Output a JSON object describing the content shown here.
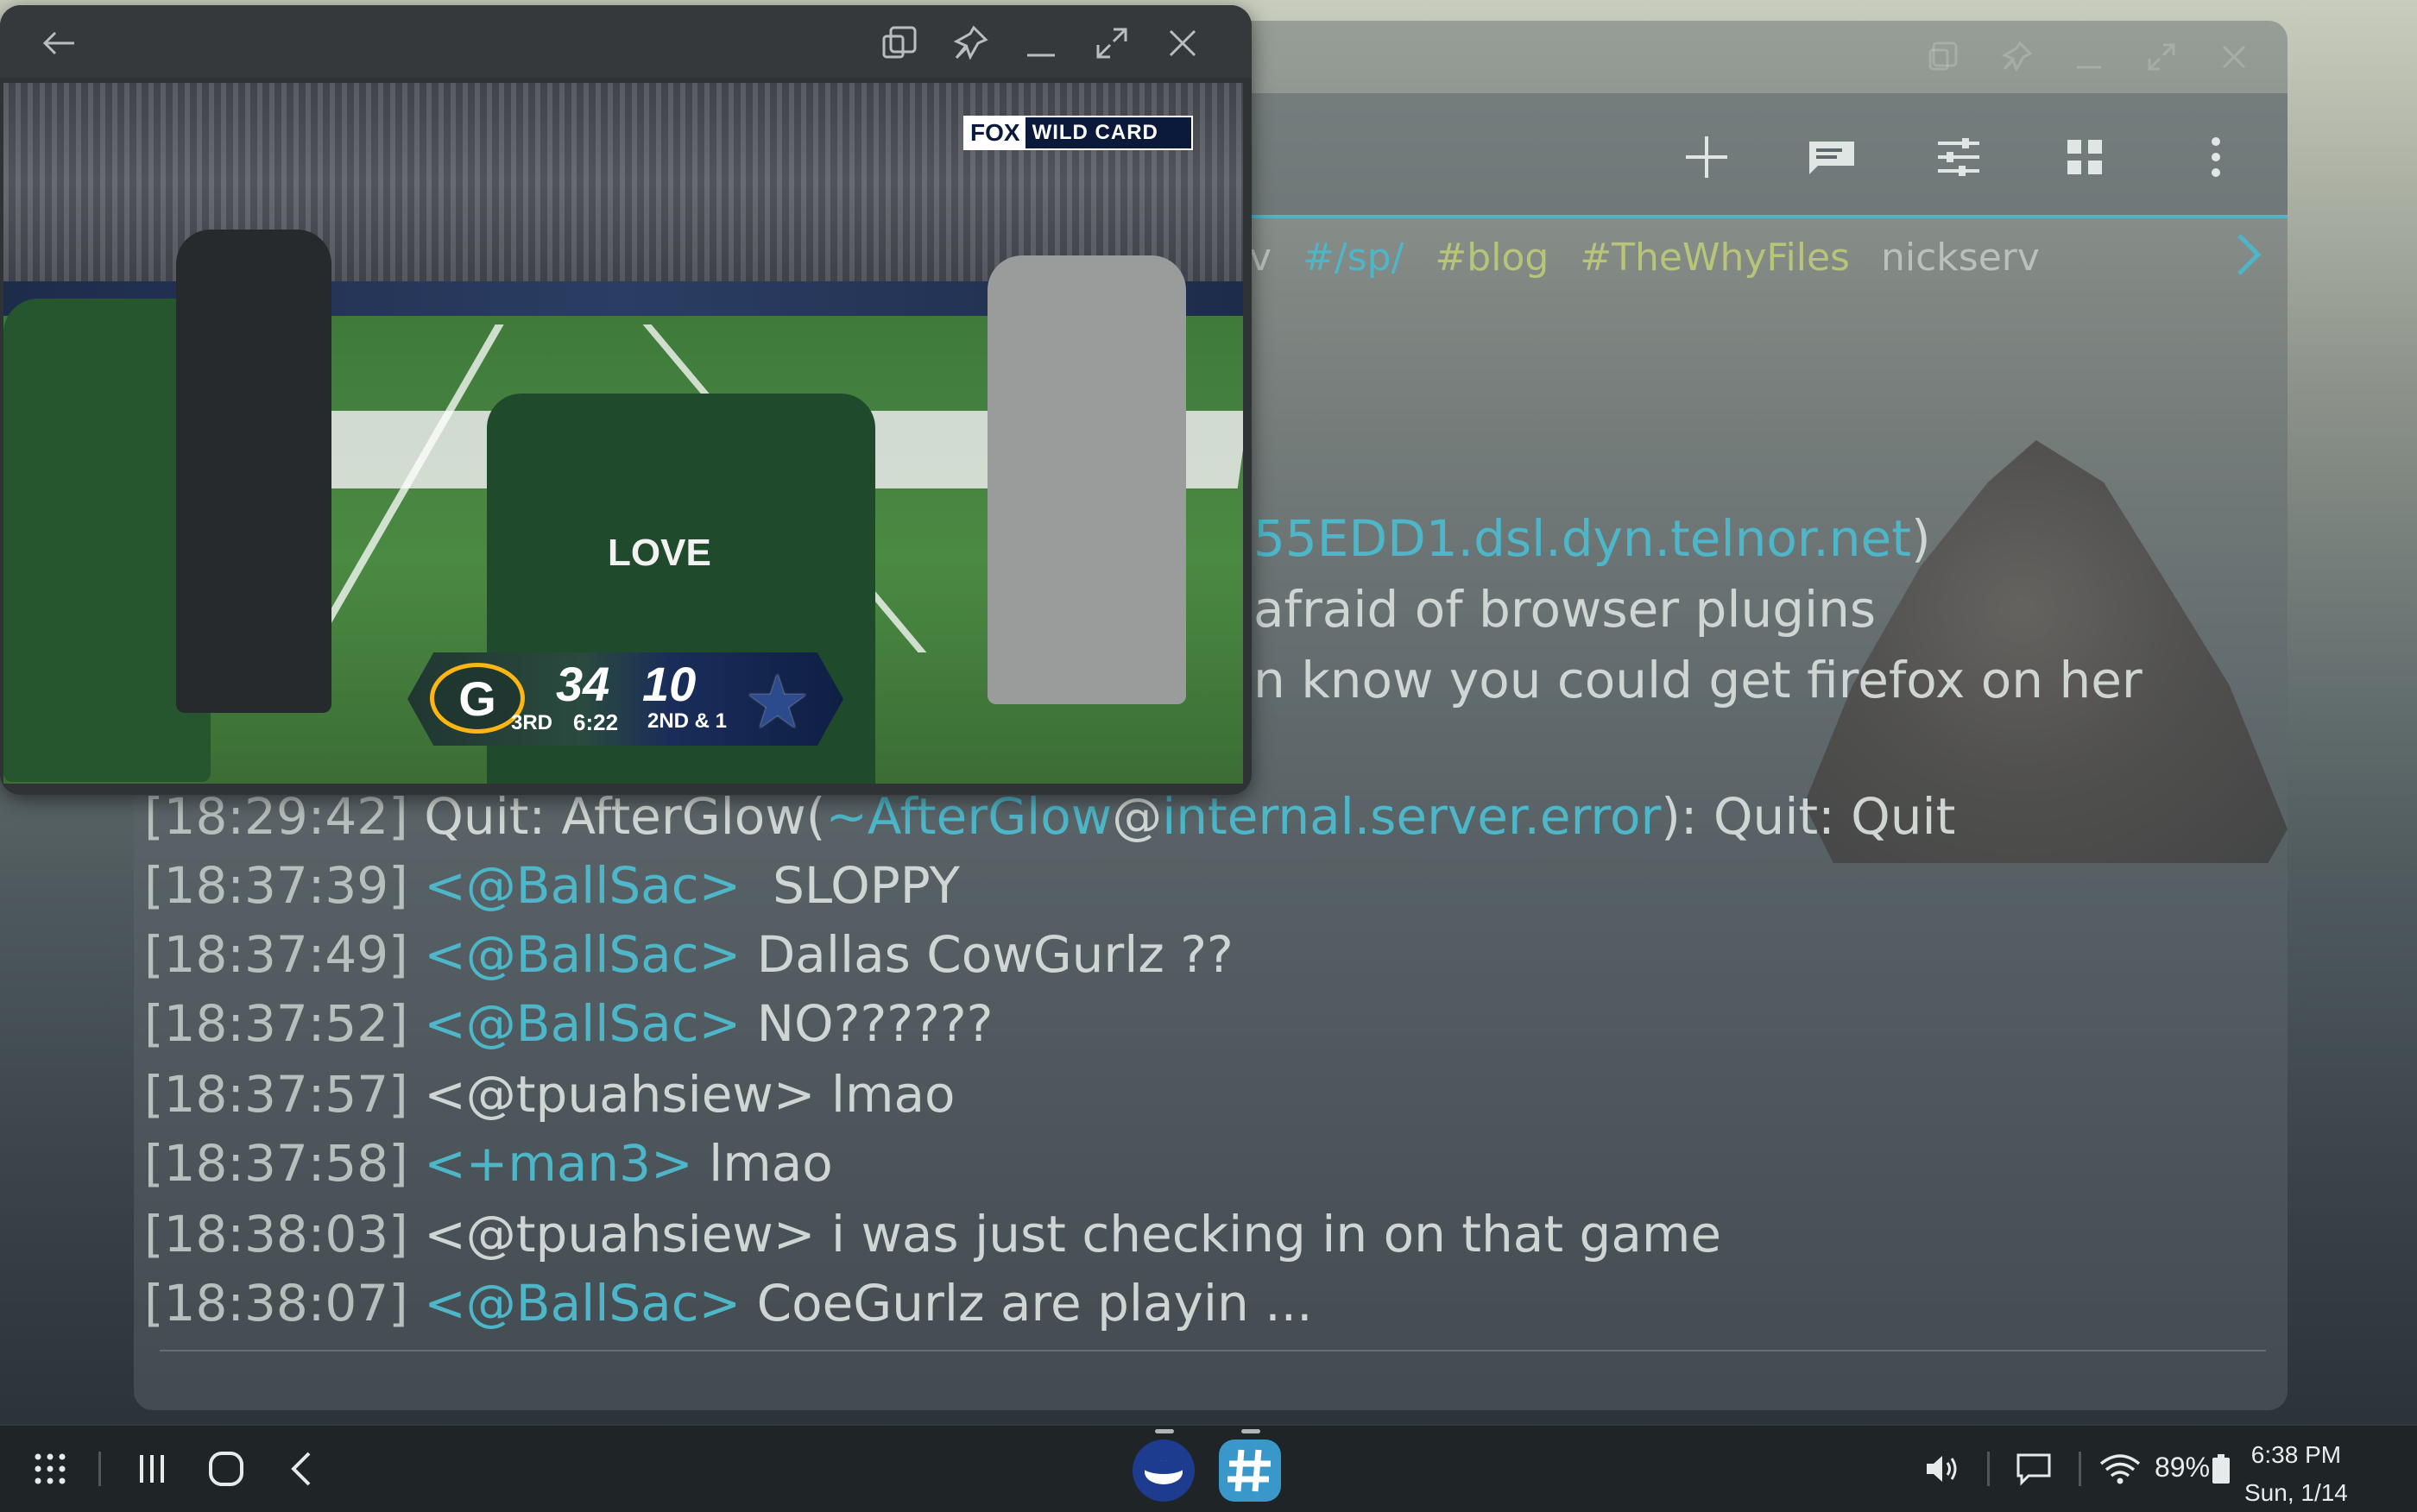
{
  "pip_window": {
    "title": "",
    "video": {
      "broadcast_logo": {
        "network": "FOX",
        "label": "WILD CARD"
      },
      "jersey_name": "LOVE",
      "scorebug": {
        "home_score": "34",
        "away_score": "10",
        "quarter": "3RD",
        "clock": "6:22",
        "down_distance": "2ND & 1"
      }
    }
  },
  "chat_window": {
    "channels": [
      {
        "label": "v",
        "style": "plain"
      },
      {
        "label": "#/sp/",
        "style": "cyan"
      },
      {
        "label": "#blog",
        "style": "olive"
      },
      {
        "label": "#TheWhyFiles",
        "style": "olive"
      },
      {
        "label": "nickserv",
        "style": "nick"
      }
    ],
    "partial_lines": [
      {
        "text": "55EDD1.dsl.dyn.telnor.net",
        "suffix": ")"
      },
      {
        "text": "afraid of browser plugins"
      },
      {
        "text": "n know you could get firefox on her"
      }
    ],
    "messages": [
      {
        "time": "[18:29:42]",
        "prefix": "Quit: AfterGlow(",
        "host_user": "~AfterGlow",
        "at": "@",
        "host": "internal.server.error",
        "rest": "): Quit: Quit"
      },
      {
        "time": "[18:37:39]",
        "nick": "<@BallSac>",
        "text": "  SLOPPY",
        "nick_color": "cyan"
      },
      {
        "time": "[18:37:49]",
        "nick": "<@BallSac>",
        "text": " Dallas CowGurlz ??",
        "nick_color": "cyan"
      },
      {
        "time": "[18:37:52]",
        "nick": "<@BallSac>",
        "text": " NO??????",
        "nick_color": "cyan"
      },
      {
        "time": "[18:37:57]",
        "nick": "<@tpuahsiew>",
        "text": " lmao",
        "nick_color": "plain"
      },
      {
        "time": "[18:37:58]",
        "nick": "<+man3>",
        "text": " lmao",
        "nick_color": "cyan"
      },
      {
        "time": "[18:38:03]",
        "nick": "<@tpuahsiew>",
        "text": " i was just checking in on that game",
        "nick_color": "plain"
      },
      {
        "time": "[18:38:07]",
        "nick": "<@BallSac>",
        "text": " CoeGurlz are playin ...",
        "nick_color": "cyan"
      }
    ]
  },
  "taskbar": {
    "battery_percent": "89%",
    "time": "6:38 PM",
    "date": "Sun, 1/14"
  },
  "colors": {
    "accent": "#4db6c8",
    "channel_olive": "#b8c478",
    "chat_text": "#cfd5d2",
    "taskbar_bg": "#1f2427"
  }
}
